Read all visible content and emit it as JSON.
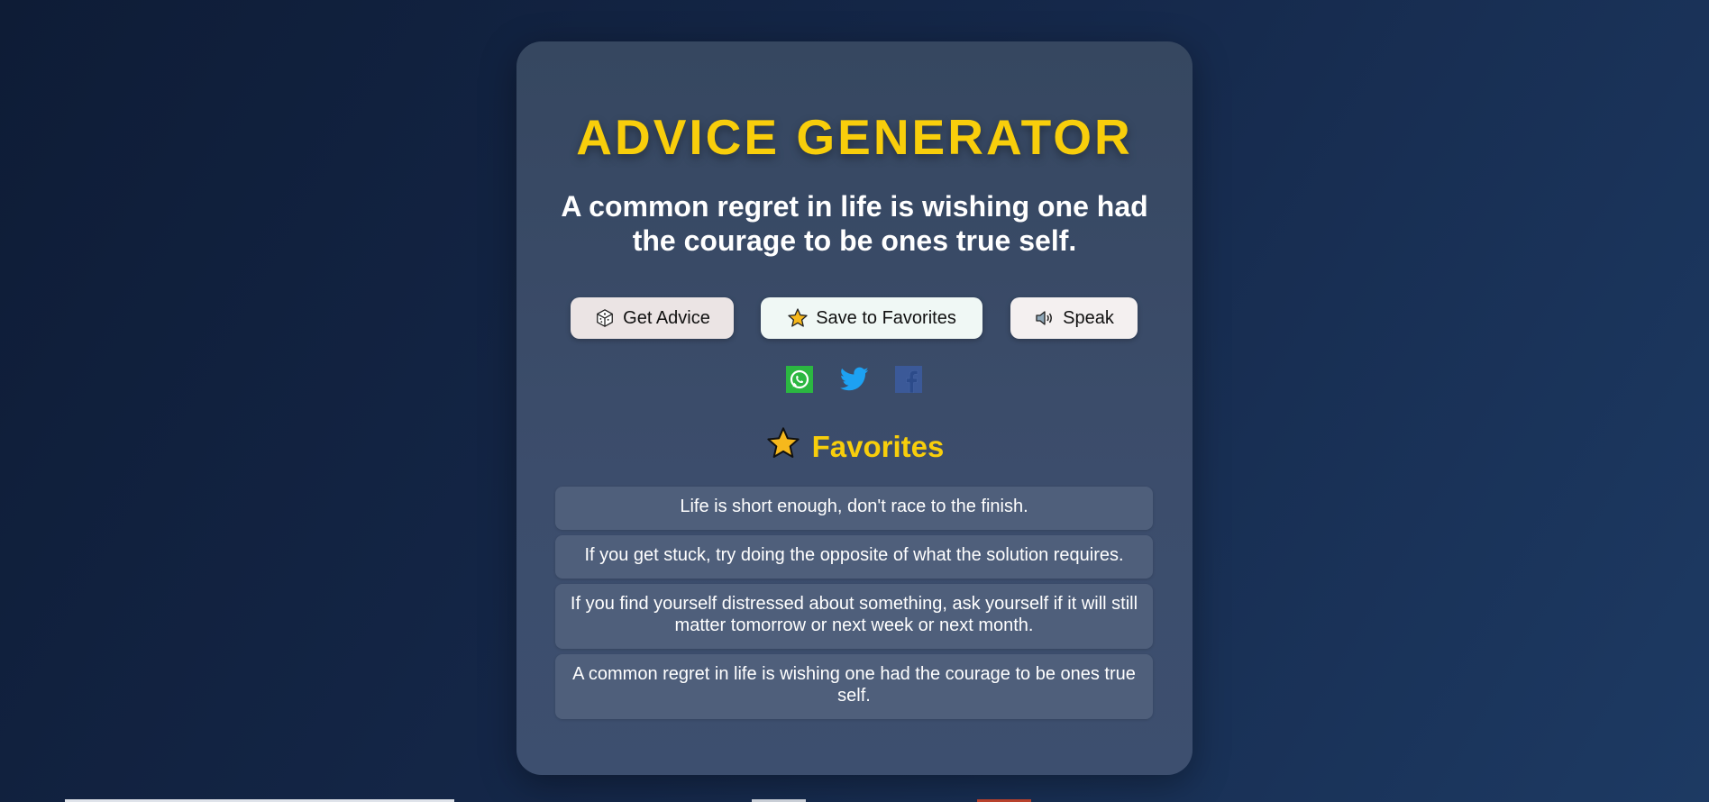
{
  "app": {
    "title": "ADVICE GENERATOR",
    "current_advice": "A common regret in life is wishing one had the courage to be ones true self."
  },
  "buttons": {
    "get_advice": {
      "label": "Get Advice",
      "icon": "dice-icon"
    },
    "save_favorites": {
      "label": "Save to Favorites",
      "icon": "star-icon"
    },
    "speak": {
      "label": "Speak",
      "icon": "speaker-icon"
    }
  },
  "share": [
    {
      "name": "whatsapp",
      "icon": "whatsapp-icon",
      "color": "#25D366"
    },
    {
      "name": "twitter",
      "icon": "twitter-icon",
      "color": "#1DA1F2"
    },
    {
      "name": "facebook",
      "icon": "facebook-icon",
      "color": "#3b5998"
    }
  ],
  "favorites": {
    "heading": "Favorites",
    "items": [
      "Life is short enough, don't race to the finish.",
      "If you get stuck, try doing the opposite of what the solution requires.",
      "If you find yourself distressed about something, ask yourself if it will still matter tomorrow or next week or next month.",
      "A common regret in life is wishing one had the courage to be ones true self."
    ]
  },
  "colors": {
    "accent": "#f8ce0b",
    "card": "#3a4a66",
    "background": "#12264a"
  }
}
